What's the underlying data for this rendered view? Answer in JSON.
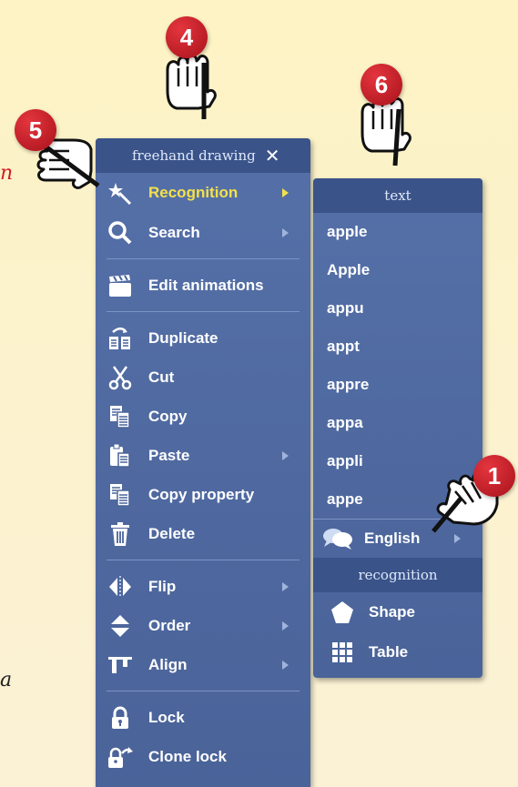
{
  "colors": {
    "highlight": "#f3e04a",
    "menu_bg": "#4f6aa1",
    "header_bg": "#3a5389",
    "badge": "#d21f2a",
    "edge_text": "#cc1f2a"
  },
  "edge_text": {
    "top": "n",
    "bottom": "a"
  },
  "main_menu": {
    "title": "freehand drawing",
    "close_icon": "close-icon",
    "items": [
      {
        "label": "Recognition",
        "icon": "magic-wand-icon",
        "submenu": true,
        "highlighted": true
      },
      {
        "label": "Search",
        "icon": "magnifier-icon",
        "submenu": true
      },
      {
        "label": "Edit animations",
        "icon": "clapperboard-icon",
        "submenu": false
      },
      {
        "label": "Duplicate",
        "icon": "duplicate-icon",
        "submenu": false
      },
      {
        "label": "Cut",
        "icon": "scissors-icon",
        "submenu": false
      },
      {
        "label": "Copy",
        "icon": "copy-icon",
        "submenu": false
      },
      {
        "label": "Paste",
        "icon": "paste-icon",
        "submenu": true
      },
      {
        "label": "Copy property",
        "icon": "copy-property-icon",
        "submenu": false
      },
      {
        "label": "Delete",
        "icon": "trash-icon",
        "submenu": false
      },
      {
        "label": "Flip",
        "icon": "flip-icon",
        "submenu": true
      },
      {
        "label": "Order",
        "icon": "order-icon",
        "submenu": true
      },
      {
        "label": "Align",
        "icon": "align-icon",
        "submenu": true
      },
      {
        "label": "Lock",
        "icon": "lock-icon",
        "submenu": false
      },
      {
        "label": "Clone lock",
        "icon": "clone-lock-icon",
        "submenu": false
      }
    ]
  },
  "sub_menu": {
    "text_header": "text",
    "candidates": [
      "apple",
      "Apple",
      "appu",
      "appt",
      "appre",
      "appa",
      "appli",
      "appe"
    ],
    "language": {
      "label": "English",
      "icon": "speech-bubbles-icon",
      "submenu": true
    },
    "recognition_header": "recognition",
    "recognition_items": [
      {
        "label": "Shape",
        "icon": "pentagon-icon"
      },
      {
        "label": "Table",
        "icon": "grid-icon"
      }
    ]
  },
  "callouts": [
    "4",
    "5",
    "6",
    "1"
  ]
}
